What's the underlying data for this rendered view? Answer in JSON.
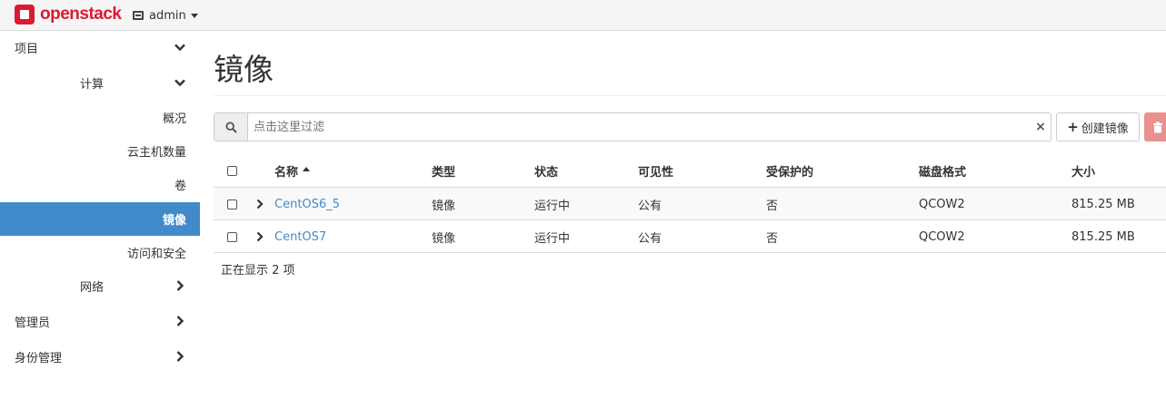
{
  "brand": {
    "name": "openstack",
    "color": "#da1a32"
  },
  "topbar": {
    "project_label": "admin"
  },
  "sidebar": {
    "items": [
      {
        "label": "项目",
        "chevron": "chevron-down"
      },
      {
        "label": "计算",
        "chevron": "chevron-down"
      },
      {
        "label": "概况"
      },
      {
        "label": "云主机数量"
      },
      {
        "label": "卷"
      },
      {
        "label": "镜像",
        "active": true
      },
      {
        "label": "访问和安全"
      },
      {
        "label": "网络",
        "chevron": "chevron-right"
      },
      {
        "label": "管理员",
        "chevron": "chevron-right"
      },
      {
        "label": "身份管理",
        "chevron": "chevron-right"
      }
    ],
    "active_color": "#428bca"
  },
  "main": {
    "title": "镜像",
    "filter": {
      "placeholder": "点击这里过滤",
      "clear": "×"
    },
    "create_button": "创建镜像",
    "delete_button_icon": "trash-icon",
    "table": {
      "columns": [
        "名称",
        "类型",
        "状态",
        "可见性",
        "受保护的",
        "磁盘格式",
        "大小"
      ],
      "rows": [
        {
          "name": "CentOS6_5",
          "type": "镜像",
          "status": "运行中",
          "visibility": "公有",
          "protected": "否",
          "format": "QCOW2",
          "size": "815.25 MB"
        },
        {
          "name": "CentOS7",
          "type": "镜像",
          "status": "运行中",
          "visibility": "公有",
          "protected": "否",
          "format": "QCOW2",
          "size": "815.25 MB"
        }
      ],
      "footer": "正在显示 2 项"
    }
  }
}
